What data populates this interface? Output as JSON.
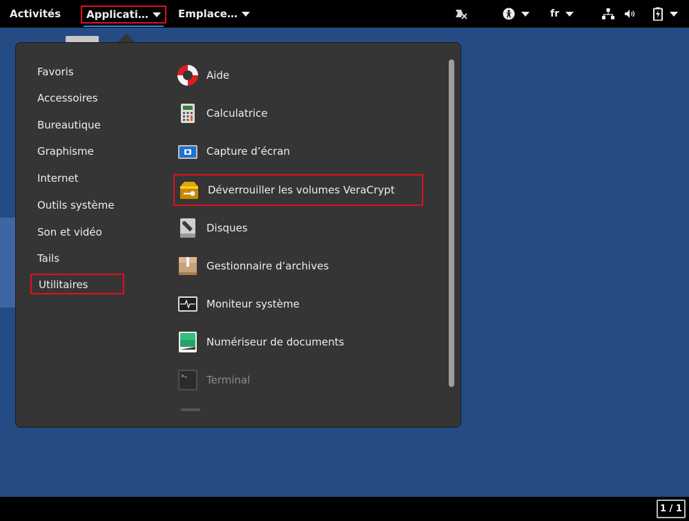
{
  "topbar": {
    "activities": "Activités",
    "applications": "Applicati…",
    "places": "Emplace…",
    "language": "fr"
  },
  "menu": {
    "categories": [
      "Favoris",
      "Accessoires",
      "Bureautique",
      "Graphisme",
      "Internet",
      "Outils système",
      "Son et vidéo",
      "Tails",
      "Utilitaires"
    ],
    "selected_category": "Utilitaires",
    "apps": [
      {
        "label": "Aide",
        "icon": "help-lifebuoy-icon"
      },
      {
        "label": "Calculatrice",
        "icon": "calculator-icon"
      },
      {
        "label": "Capture d’écran",
        "icon": "screenshot-icon"
      },
      {
        "label": "Déverrouiller les volumes VeraCrypt",
        "icon": "veracrypt-icon"
      },
      {
        "label": "Disques",
        "icon": "disks-icon"
      },
      {
        "label": "Gestionnaire d’archives",
        "icon": "archive-manager-icon"
      },
      {
        "label": "Moniteur système",
        "icon": "system-monitor-icon"
      },
      {
        "label": "Numériseur de documents",
        "icon": "document-scanner-icon"
      },
      {
        "label": "Terminal",
        "icon": "terminal-icon"
      }
    ],
    "highlighted_app": "Déverrouiller les volumes VeraCrypt"
  },
  "bottombar": {
    "pager": "1 / 1"
  },
  "colors": {
    "highlight": "#e0101c",
    "desktop": "#254b84",
    "menu_bg": "#353535",
    "accent": "#3584e4"
  }
}
